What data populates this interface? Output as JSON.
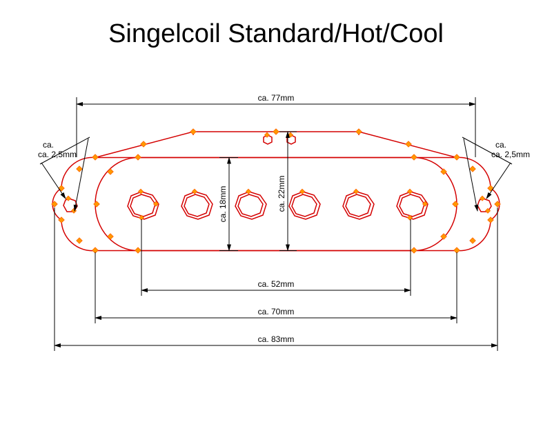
{
  "title": "Singelcoil Standard/Hot/Cool",
  "dimensions": {
    "outer_width_top": "ca. 77mm",
    "outer_width_bottom": "ca. 83mm",
    "inner_width_cover": "ca. 70mm",
    "pole_span": "ca. 52mm",
    "height_narrow": "ca. 18mm",
    "height_wide": "ca. 22mm",
    "screw_left": "ca. 2,5mm",
    "screw_right": "ca. 2,5mm"
  },
  "geometry": {
    "outer_plate": {
      "width_mm": 83,
      "lobes": 2
    },
    "cover": {
      "width_mm": 70,
      "height_mm": 18
    },
    "trapezoid_top": {
      "width_mm": 77,
      "height_mm": 22
    },
    "poles": {
      "count": 6,
      "span_mm": 52,
      "diameter_mm_approx": 8
    },
    "mount_screw_holes": {
      "count": 2,
      "diameter_mm_approx": 2.5
    },
    "top_small_holes": {
      "count": 2
    }
  }
}
